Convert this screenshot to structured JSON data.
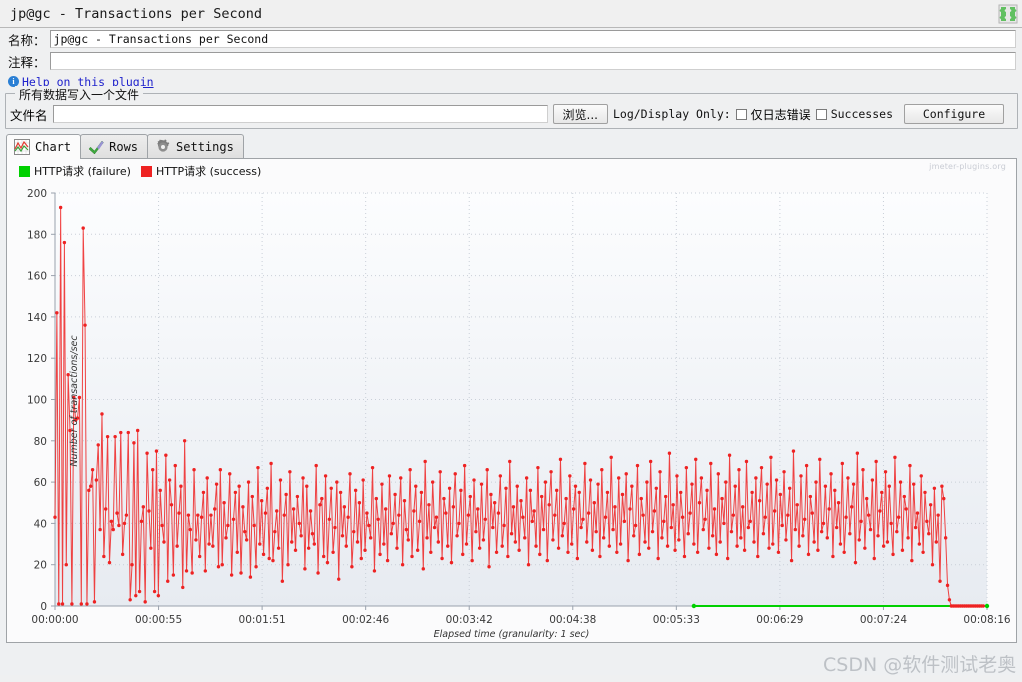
{
  "window": {
    "title": "jp@gc - Transactions per Second",
    "plugin_icon": "puzzle-icon"
  },
  "form": {
    "name_label": "名称：",
    "name_value": "jp@gc - Transactions per Second",
    "comment_label": "注释：",
    "comment_value": "",
    "help_link": "Help on this plugin",
    "info_icon": "i"
  },
  "file_group": {
    "title": "所有数据写入一个文件",
    "filename_label": "文件名",
    "filename_value": "",
    "browse_button": "浏览...",
    "log_display_label": "Log/Display Only:",
    "errors_only_label": "仅日志错误",
    "errors_only_checked": false,
    "successes_label": "Successes",
    "successes_checked": false,
    "configure_button": "Configure"
  },
  "tabs": [
    {
      "label": "Chart",
      "icon": "chart-icon",
      "active": true
    },
    {
      "label": "Rows",
      "icon": "check-icon",
      "active": false
    },
    {
      "label": "Settings",
      "icon": "gear-icon",
      "active": false
    }
  ],
  "chart_data": {
    "type": "line",
    "title": "",
    "xlabel": "Elapsed time (granularity: 1 sec)",
    "ylabel": "Number of transactions/sec",
    "watermark": "jmeter-plugins.org",
    "overlay_watermark": "CSDN @软件测试老奥",
    "ylim": [
      0,
      200
    ],
    "yticks": [
      0,
      20,
      40,
      60,
      80,
      100,
      120,
      140,
      160,
      180,
      200
    ],
    "xticks": [
      "00:00:00",
      "00:00:55",
      "00:01:51",
      "00:02:46",
      "00:03:42",
      "00:04:38",
      "00:05:33",
      "00:06:29",
      "00:07:24",
      "00:08:16"
    ],
    "xlim": [
      0,
      496
    ],
    "grid": true,
    "legend_position": "top-left",
    "series": [
      {
        "name": "HTTP请求 (failure)",
        "color": "#00d000",
        "x": [
          340,
          496
        ],
        "values": [
          0,
          0
        ]
      },
      {
        "name": "HTTP请求 (success)",
        "color": "#ee2222",
        "x_start": 0,
        "x_step": 1,
        "values": [
          43,
          142,
          1,
          193,
          1,
          176,
          20,
          112,
          85,
          1,
          101,
          90,
          91,
          101,
          1,
          183,
          136,
          1,
          56,
          58,
          66,
          2,
          61,
          78,
          37,
          93,
          24,
          47,
          82,
          21,
          41,
          37,
          82,
          45,
          39,
          84,
          25,
          40,
          44,
          84,
          3,
          20,
          79,
          5,
          85,
          7,
          41,
          48,
          2,
          74,
          46,
          28,
          66,
          7,
          75,
          5,
          56,
          39,
          31,
          73,
          12,
          61,
          49,
          15,
          68,
          29,
          45,
          58,
          9,
          80,
          17,
          44,
          37,
          16,
          66,
          32,
          44,
          24,
          43,
          55,
          17,
          62,
          30,
          44,
          29,
          47,
          59,
          19,
          66,
          20,
          50,
          33,
          39,
          64,
          15,
          42,
          55,
          26,
          58,
          16,
          48,
          36,
          32,
          60,
          14,
          53,
          39,
          19,
          67,
          30,
          51,
          25,
          45,
          57,
          23,
          69,
          22,
          36,
          46,
          28,
          61,
          12,
          44,
          54,
          20,
          65,
          31,
          47,
          27,
          53,
          40,
          34,
          62,
          18,
          58,
          28,
          46,
          35,
          30,
          68,
          16,
          49,
          52,
          24,
          63,
          21,
          42,
          57,
          26,
          38,
          60,
          13,
          55,
          34,
          48,
          29,
          43,
          64,
          19,
          36,
          56,
          31,
          50,
          23,
          61,
          27,
          45,
          39,
          33,
          67,
          17,
          52,
          42,
          25,
          59,
          30,
          47,
          22,
          63,
          35,
          40,
          54,
          28,
          44,
          62,
          20,
          51,
          37,
          32,
          66,
          24,
          46,
          58,
          27,
          41,
          55,
          18,
          70,
          33,
          49,
          26,
          60,
          38,
          43,
          31,
          65,
          23,
          52,
          45,
          29,
          57,
          21,
          48,
          64,
          34,
          40,
          56,
          25,
          68,
          30,
          44,
          53,
          22,
          61,
          36,
          47,
          28,
          59,
          32,
          42,
          66,
          19,
          54,
          38,
          50,
          26,
          45,
          63,
          29,
          39,
          57,
          24,
          70,
          35,
          48,
          31,
          58,
          27,
          51,
          43,
          33,
          62,
          20,
          56,
          41,
          46,
          29,
          67,
          25,
          53,
          37,
          60,
          22,
          49,
          65,
          32,
          44,
          56,
          28,
          71,
          34,
          40,
          52,
          26,
          63,
          30,
          47,
          58,
          23,
          55,
          38,
          42,
          69,
          31,
          45,
          61,
          27,
          50,
          36,
          59,
          24,
          66,
          33,
          43,
          55,
          29,
          72,
          37,
          48,
          26,
          62,
          30,
          54,
          41,
          64,
          22,
          47,
          58,
          34,
          39,
          68,
          25,
          52,
          44,
          31,
          60,
          28,
          70,
          36,
          46,
          57,
          23,
          65,
          33,
          41,
          53,
          29,
          74,
          38,
          49,
          27,
          63,
          32,
          55,
          43,
          24,
          67,
          35,
          45,
          59,
          30,
          71,
          26,
          50,
          62,
          37,
          42,
          56,
          28,
          69,
          34,
          47,
          25,
          64,
          31,
          52,
          40,
          60,
          23,
          73,
          36,
          44,
          58,
          29,
          66,
          33,
          48,
          27,
          70,
          38,
          41,
          55,
          31,
          62,
          24,
          51,
          67,
          35,
          43,
          59,
          28,
          72,
          30,
          46,
          61,
          26,
          54,
          39,
          65,
          32,
          44,
          57,
          22,
          75,
          37,
          49,
          29,
          63,
          34,
          42,
          68,
          25,
          53,
          45,
          31,
          60,
          27,
          71,
          36,
          40,
          58,
          33,
          47,
          64,
          24,
          56,
          38,
          50,
          30,
          69,
          26,
          43,
          62,
          35,
          48,
          59,
          21,
          74,
          32,
          41,
          66,
          28,
          52,
          44,
          37,
          61,
          23,
          70,
          34,
          46,
          55,
          29,
          65,
          31,
          58,
          40,
          25,
          72,
          36,
          43,
          60,
          27,
          53,
          47,
          33,
          68,
          22,
          59,
          38,
          45,
          30,
          63,
          26,
          55,
          41,
          35,
          49,
          20,
          57,
          31,
          44,
          12,
          58,
          52,
          33,
          10,
          3,
          0,
          0,
          0,
          0,
          0,
          0,
          0,
          0,
          0,
          0,
          0,
          0,
          0,
          0,
          0,
          0,
          0,
          0
        ]
      }
    ]
  }
}
